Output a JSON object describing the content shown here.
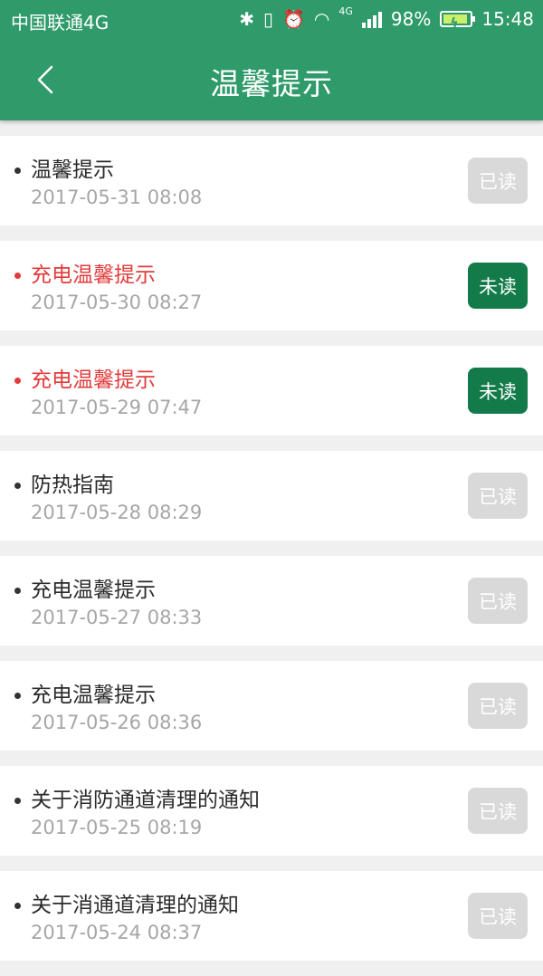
{
  "status_bar": {
    "carrier": "中国联通4G",
    "battery": "98%",
    "time": "15:48",
    "network_label": "4G"
  },
  "header": {
    "title": "温馨提示",
    "back_icon": "chevron-left-icon"
  },
  "colors": {
    "primary": "#2f9a6a",
    "unread_badge": "#137a4a",
    "read_badge": "#d9d9d9",
    "unread_text": "#e23b3b"
  },
  "notices": [
    {
      "title": "温馨提示",
      "date": "2017-05-31 08:08",
      "status": "已读",
      "unread": false
    },
    {
      "title": "充电温馨提示",
      "date": "2017-05-30 08:27",
      "status": "未读",
      "unread": true
    },
    {
      "title": "充电温馨提示",
      "date": "2017-05-29 07:47",
      "status": "未读",
      "unread": true
    },
    {
      "title": "防热指南",
      "date": "2017-05-28 08:29",
      "status": "已读",
      "unread": false
    },
    {
      "title": "充电温馨提示",
      "date": "2017-05-27 08:33",
      "status": "已读",
      "unread": false
    },
    {
      "title": "充电温馨提示",
      "date": "2017-05-26 08:36",
      "status": "已读",
      "unread": false
    },
    {
      "title": "关于消防通道清理的通知",
      "date": "2017-05-25 08:19",
      "status": "已读",
      "unread": false
    },
    {
      "title": "关于消通道清理的通知",
      "date": "2017-05-24 08:37",
      "status": "已读",
      "unread": false
    }
  ]
}
